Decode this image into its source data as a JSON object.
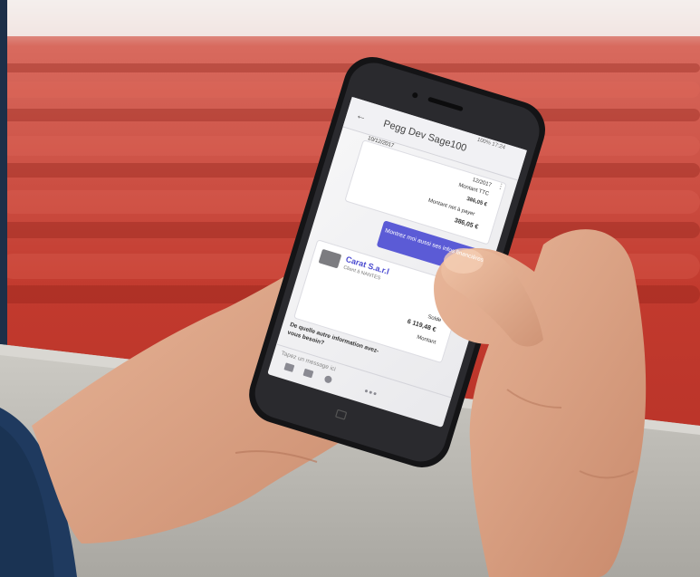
{
  "photo": {
    "description_colors": {
      "stadium_red": "#c0392b",
      "concrete": "#b8b6b0",
      "sleeve_navy": "#1f3a5f",
      "accent_purple": "#5b5bd6"
    }
  },
  "phone": {
    "app_title": "Pegg Dev Sage100",
    "status_bar": "100% 17:24",
    "invoice": {
      "date_left": "10/12/2017",
      "date_right": "12/2017",
      "amount_ttc_label": "Montant TTC",
      "amount_ttc_value": "386,05 €",
      "net_label": "Montant net à payer",
      "net_value": "386,05 €"
    },
    "user_message": "Montrez moi aussi ses infos financières",
    "client_card": {
      "name": "Carat S.a.r.l",
      "subtitle": "Client à NANTES",
      "balance_label": "Solde",
      "balance_value": "6 119,48 €",
      "extra_label": "Montant"
    },
    "bot_question": "De quelle autre information avez-vous besoin?",
    "input_placeholder": "Tapez un message ici"
  }
}
